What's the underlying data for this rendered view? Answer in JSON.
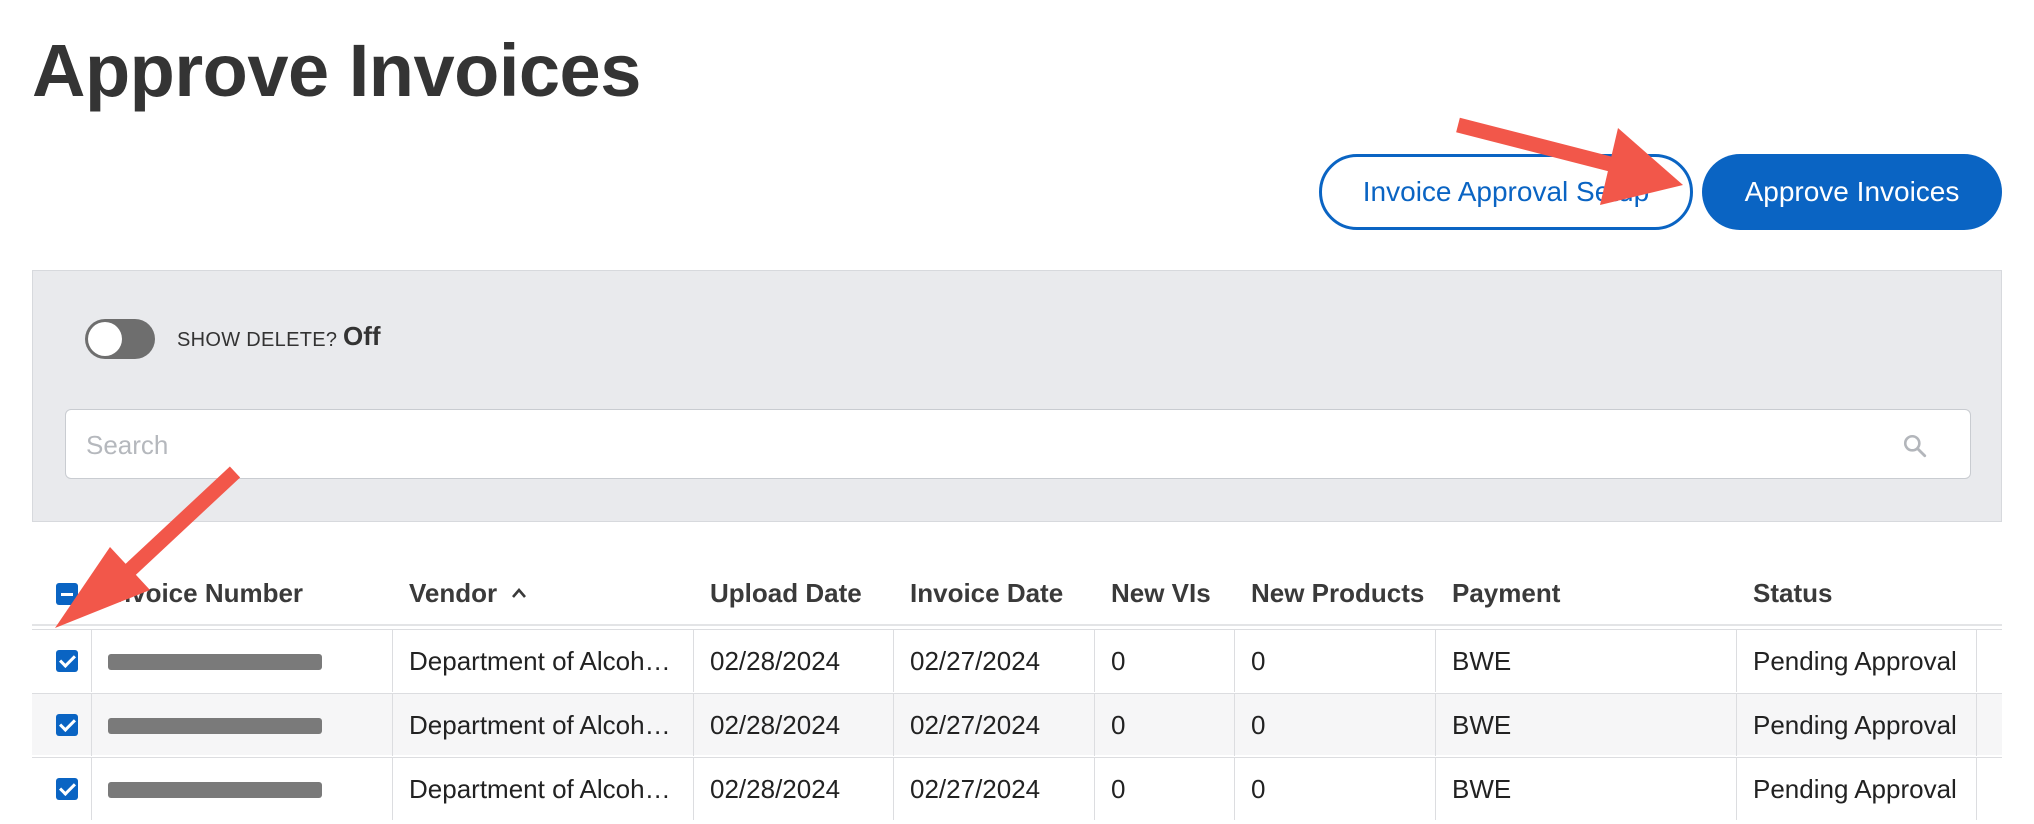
{
  "header": {
    "title": "Approve Invoices",
    "setup_button": "Invoice Approval Setup",
    "approve_button": "Approve Invoices"
  },
  "filters": {
    "show_delete_label": "SHOW DELETE?",
    "show_delete_state": "Off",
    "search_placeholder": "Search"
  },
  "table": {
    "columns": [
      "Invoice Number",
      "Vendor",
      "Upload Date",
      "Invoice Date",
      "New VIs",
      "New Products",
      "Payment",
      "Status"
    ],
    "vendor_sort": "ascending",
    "rows": [
      {
        "vendor": "Department of Alcoh…",
        "upload_date": "02/28/2024",
        "invoice_date": "02/27/2024",
        "new_vis": "0",
        "new_products": "0",
        "payment": "BWE",
        "status": "Pending Approval",
        "checked": true
      },
      {
        "vendor": "Department of Alcoh…",
        "upload_date": "02/28/2024",
        "invoice_date": "02/27/2024",
        "new_vis": "0",
        "new_products": "0",
        "payment": "BWE",
        "status": "Pending Approval",
        "checked": true
      },
      {
        "vendor": "Department of Alcoh…",
        "upload_date": "02/28/2024",
        "invoice_date": "02/27/2024",
        "new_vis": "0",
        "new_products": "0",
        "payment": "BWE",
        "status": "Pending Approval",
        "checked": true
      }
    ]
  },
  "annotations": {
    "arrow_color": "#f2574a"
  },
  "colors": {
    "primary": "#0a64c3",
    "panel_bg": "#e9eaed"
  }
}
